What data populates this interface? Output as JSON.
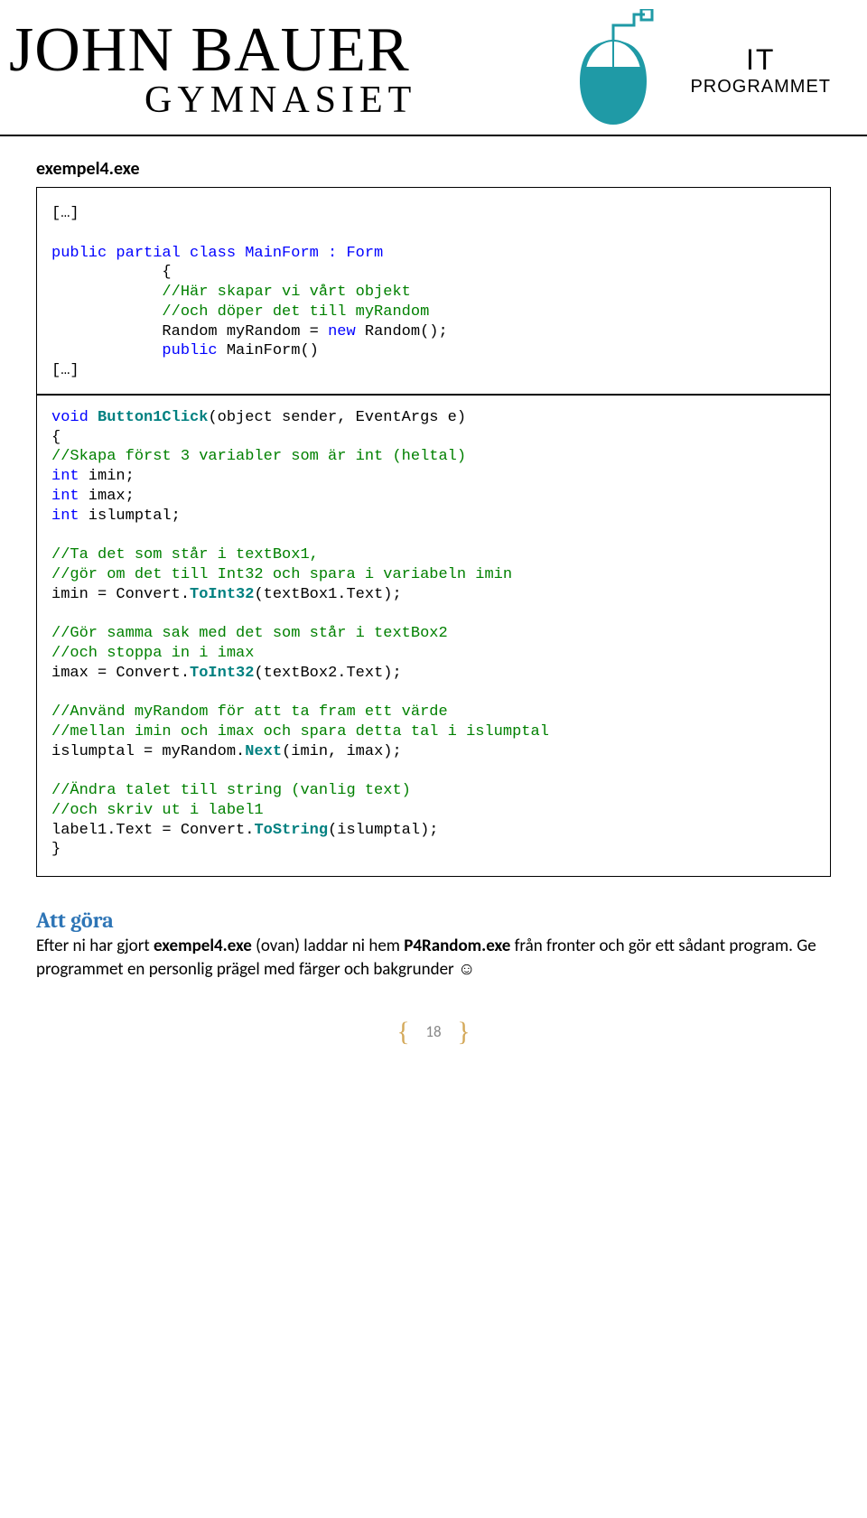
{
  "header": {
    "brand_name": "JOHN BAUER",
    "brand_sub": "GYMNASIET",
    "it_label": "IT",
    "program_label": "PROGRAMMET"
  },
  "code": {
    "filename": "exempel4.exe",
    "omit": "[…]",
    "line2": "public partial class MainForm : Form",
    "line3": "{",
    "line4": "//Här skapar vi vårt objekt",
    "line5": "//och döper det till myRandom",
    "line6a": "Random myRandom = ",
    "line6b": "new",
    "line6c": " Random();",
    "line7a": "public",
    "line7b": " MainForm()",
    "line9a": "void",
    "line9b": " Button1Click",
    "line9c": "(object sender, EventArgs e)",
    "line10": "{",
    "line11": "//Skapa först 3 variabler som är int (heltal)",
    "line12a": "int",
    "line12b": " imin;",
    "line13a": "int",
    "line13b": " imax;",
    "line14a": "int",
    "line14b": " islumptal;",
    "line16": "//Ta det som står i textBox1,",
    "line17": "//gör om det till Int32 och spara i variabeln imin",
    "line18a": "imin = Convert.",
    "line18b": "ToInt32",
    "line18c": "(textBox1.Text);",
    "line20": "//Gör samma sak med det som står i textBox2",
    "line21": "//och stoppa in i imax",
    "line22a": "imax = Convert.",
    "line22b": "ToInt32",
    "line22c": "(textBox2.Text);",
    "line24": "//Använd myRandom för att ta fram ett värde",
    "line25": "//mellan imin och imax och spara detta tal i islumptal",
    "line26a": "islumptal = myRandom.",
    "line26b": "Next",
    "line26c": "(imin, imax);",
    "line28": "//Ändra talet till string (vanlig text)",
    "line29": "//och skriv ut i label1",
    "line30a": "label1.Text = Convert.",
    "line30b": "ToString",
    "line30c": "(islumptal);",
    "line31": "}"
  },
  "todo": {
    "heading": "Att göra",
    "text_1": "Efter ni har gjort ",
    "bold_1": "exempel4.exe",
    "text_2": " (ovan) laddar ni hem ",
    "bold_2": "P4Random.exe",
    "text_3": " från fronter och gör ett sådant program.  Ge programmet en personlig prägel med färger och bakgrunder ☺"
  },
  "page_number": "18"
}
